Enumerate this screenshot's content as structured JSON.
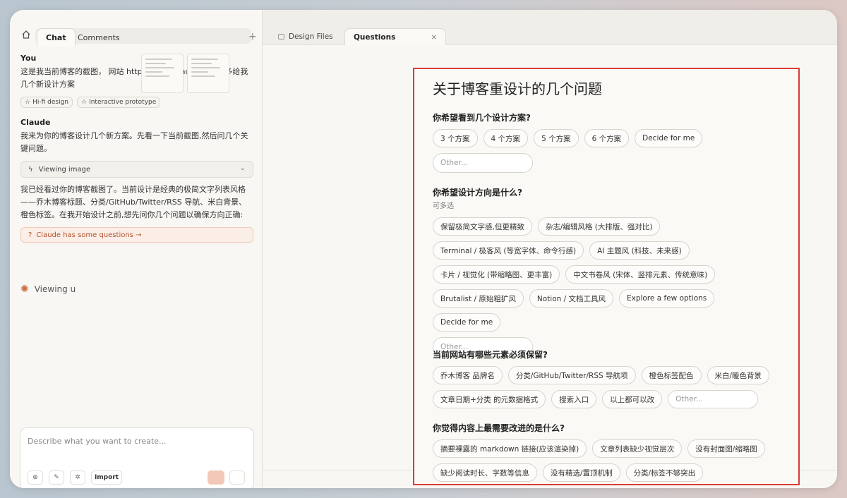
{
  "left": {
    "tabs": [
      "Chat",
      "Comments"
    ],
    "you_label": "You",
    "you_message": "这是我当前博客的截图， 网站 https://blog.qiaomu.ai/  你多给我几个新设计方案",
    "chips": [
      "Hi-fi design",
      "Interactive prototype"
    ],
    "claude_label": "Claude",
    "claude_message_1": "我来为你的博客设计几个新方案。先看一下当前截图,然后问几个关键问题。",
    "viewing_image": "Viewing image",
    "claude_message_2": "我已经看过你的博客截图了。当前设计是经典的极简文字列表风格——乔木博客标题、分类/GitHub/Twitter/RSS 导航、米白背景、橙色标签。在我开始设计之前,想先问你几个问题以确保方向正确:",
    "questions_link": "Claude has some questions →",
    "status": "Viewing u",
    "composer_placeholder": "Describe what you want to create...",
    "import_label": "Import"
  },
  "right": {
    "tabs": [
      "Design Files",
      "Questions"
    ],
    "close_icon": "×",
    "title": "关于博客重设计的几个问题",
    "q1": {
      "label": "你希望看到几个设计方案?",
      "options": [
        "3 个方案",
        "4 个方案",
        "5 个方案",
        "6 个方案",
        "Decide for me"
      ],
      "other": "Other..."
    },
    "q2": {
      "label": "你希望设计方向是什么?",
      "sub": "可多选",
      "options": [
        "保留极简文字感,但更精致",
        "杂志/编辑风格 (大排版、强对比)",
        "Terminal / 极客风 (等宽字体、命令行感)",
        "AI 主题风 (科技、未来感)",
        "卡片 / 视觉化 (带缩略图、更丰富)",
        "中文书卷风 (宋体、竖排元素、传统意味)",
        "Brutalist / 原始粗犷风",
        "Notion / 文档工具风",
        "Explore a few options",
        "Decide for me"
      ],
      "other": "Other..."
    },
    "q3": {
      "label": "当前网站有哪些元素必须保留?",
      "options": [
        "乔木博客 品牌名",
        "分类/GitHub/Twitter/RSS 导航项",
        "橙色标签配色",
        "米白/暖色背景",
        "文章日期+分类 的元数据格式",
        "搜索入口",
        "以上都可以改"
      ],
      "other": "Other..."
    },
    "q4": {
      "label": "你觉得内容上最需要改进的是什么?",
      "options": [
        "摘要裸露的 markdown 链接(应该渲染掉)",
        "文章列表缺少视觉层次",
        "没有封面图/缩略图",
        "缺少阅读时长、字数等信息",
        "没有精选/置顶机制",
        "分类/标签不够突出"
      ]
    },
    "highlight_color": "#d93b3b"
  }
}
